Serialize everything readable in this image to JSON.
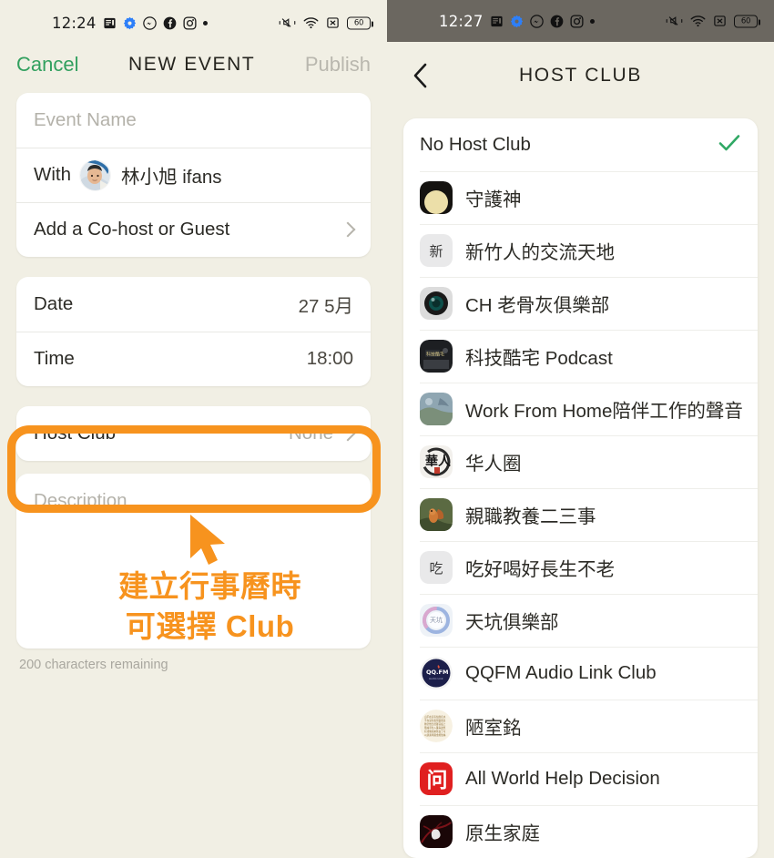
{
  "colors": {
    "background": "#f1efe4",
    "accent_orange": "#f7931e",
    "green": "#32a05f",
    "card_white": "#ffffff",
    "status_dark": "#6b6760"
  },
  "left": {
    "status_bar": {
      "time": "12:24",
      "battery": "60",
      "icons": [
        "news-icon",
        "gear-icon",
        "messenger-icon",
        "facebook-icon",
        "instagram-icon",
        "dot-icon"
      ],
      "right_icons": [
        "vibrate-mute-icon",
        "wifi-icon",
        "no-sim-icon",
        "battery-icon"
      ]
    },
    "nav": {
      "cancel": "Cancel",
      "title": "NEW EVENT",
      "publish": "Publish"
    },
    "form": {
      "event_name_placeholder": "Event Name",
      "with_label": "With",
      "host_name": "林小旭 ifans",
      "add_cohost": "Add a Co-host or Guest",
      "date_label": "Date",
      "date_value": "27 5月",
      "time_label": "Time",
      "time_value": "18:00",
      "host_club_label": "Host Club",
      "host_club_value": "None",
      "description_placeholder": "Description",
      "char_count": "200 characters remaining"
    },
    "annotation": {
      "line1": "建立行事曆時",
      "line2": "可選擇 Club"
    }
  },
  "right": {
    "status_bar": {
      "time": "12:27",
      "battery": "60",
      "icons": [
        "news-icon",
        "gear-icon",
        "messenger-icon",
        "facebook-icon",
        "instagram-icon",
        "dot-icon"
      ],
      "right_icons": [
        "vibrate-mute-icon",
        "wifi-icon",
        "no-sim-icon",
        "battery-icon"
      ]
    },
    "nav": {
      "back": "back-chevron-icon",
      "title": "HOST CLUB"
    },
    "clubs": [
      {
        "label": "No Host Club",
        "selected": true,
        "icon": null
      },
      {
        "label": "守護神",
        "selected": false,
        "icon": "guardian-avatar"
      },
      {
        "label": "新竹人的交流天地",
        "selected": false,
        "icon": "text-avatar",
        "icon_text": "新"
      },
      {
        "label": "CH 老骨灰俱樂部",
        "selected": false,
        "icon": "lens-avatar"
      },
      {
        "label": "科技酷宅 Podcast",
        "selected": false,
        "icon": "tech-avatar"
      },
      {
        "label": "Work From Home陪伴工作的聲音",
        "selected": false,
        "icon": "photo-avatar"
      },
      {
        "label": "华人圈",
        "selected": false,
        "icon": "ink-avatar"
      },
      {
        "label": "親職教養二三事",
        "selected": false,
        "icon": "squirrel-avatar"
      },
      {
        "label": "吃好喝好長生不老",
        "selected": false,
        "icon": "text-avatar",
        "icon_text": "吃"
      },
      {
        "label": "天坑俱樂部",
        "selected": false,
        "icon": "ring-avatar"
      },
      {
        "label": "QQFM Audio Link Club",
        "selected": false,
        "icon": "qqfm-avatar"
      },
      {
        "label": "陋室銘",
        "selected": false,
        "icon": "calligraphy-avatar"
      },
      {
        "label": "All World Help Decision",
        "selected": false,
        "icon": "wen-avatar"
      },
      {
        "label": "原生家庭",
        "selected": false,
        "icon": "dark-red-avatar"
      }
    ]
  }
}
